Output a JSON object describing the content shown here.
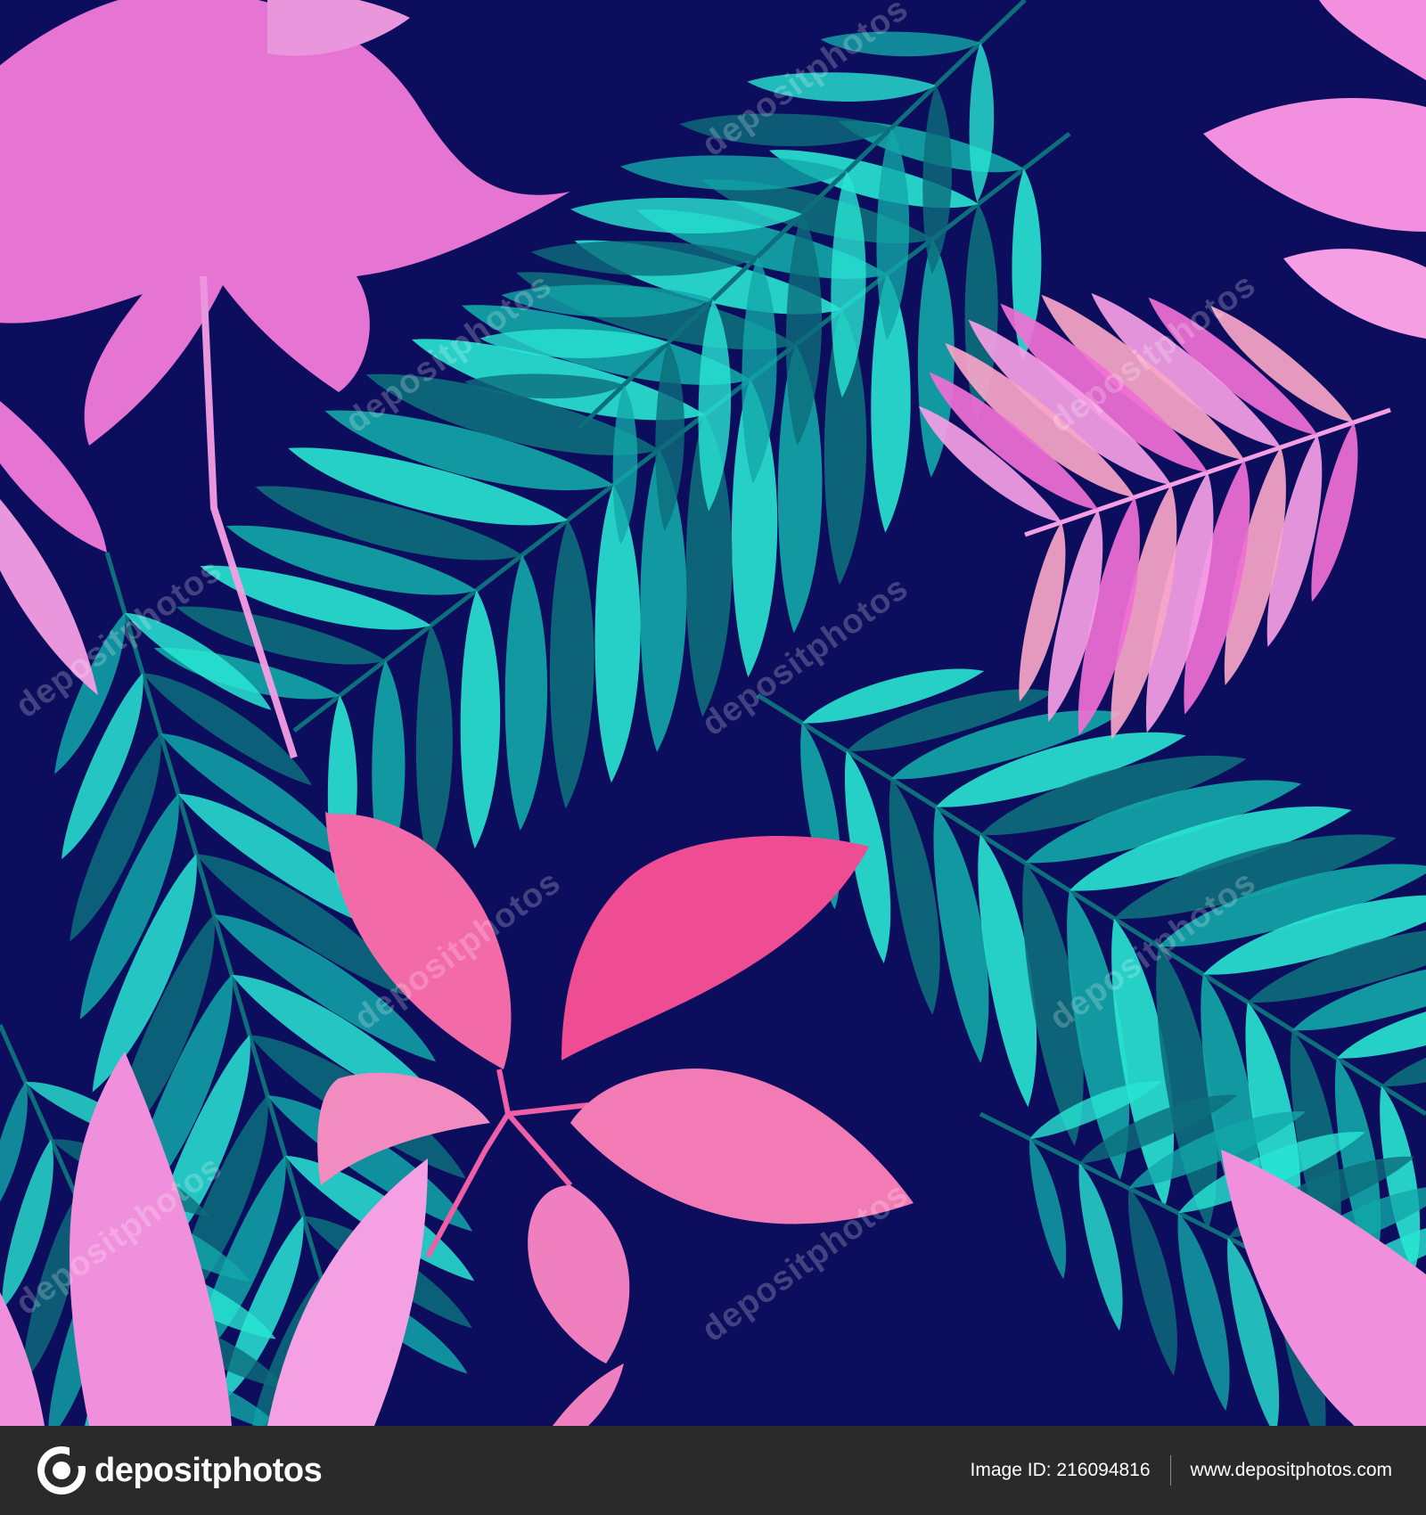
{
  "image": {
    "background_color": "#0c0d5c",
    "palette": {
      "teal_dark": "#0d6e7c",
      "teal": "#12a7a9",
      "teal_light": "#29e6d3",
      "pink": "#f06fd4",
      "pink_light": "#f59ee4",
      "magenta": "#ef3f92",
      "coral_pink": "#f8a5c8"
    },
    "watermark_text": "depositphotos"
  },
  "footer": {
    "logo_text": "depositphotos",
    "logo_icon": "depositphotos-logo-icon",
    "image_id_label": "Image ID:",
    "image_id": "216094816",
    "site_url": "www.depositphotos.com",
    "background_color": "#2a2a2a"
  }
}
